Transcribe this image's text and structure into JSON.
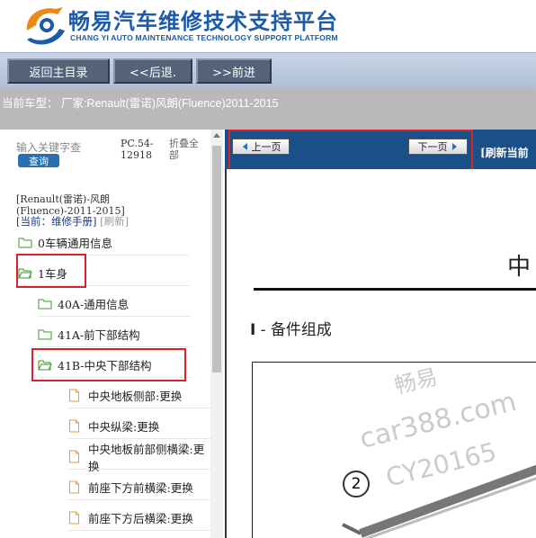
{
  "header": {
    "title": "畅易汽车维修技术支持平台",
    "subtitle": "CHANG YI AUTO MAINTENANCE TECHNOLOGY SUPPORT PLATFORM"
  },
  "toolbar": {
    "home_label": "返回主目录",
    "back_label": "<<后退.",
    "forward_label": ">>前进"
  },
  "vehicle": {
    "text": "当前车型： 厂家:Renault(雷诺)风朗(Fluence)2011-2015"
  },
  "sidebar": {
    "search_placeholder": "输入关键字查",
    "query_label": "查询",
    "pc_code": "PC.54-12918",
    "fold_label": "折叠全部",
    "crumb_car": "[Renault(雷诺)-风朗(Fluence)-2011-2015]",
    "crumb_current": "[当前：维修手册]",
    "refresh_label": "[刷新]",
    "tree": [
      {
        "label": "0车辆通用信息",
        "type": "folder"
      },
      {
        "label": "1车身",
        "type": "folder-open"
      },
      {
        "label": "40A-通用信息",
        "type": "folder"
      },
      {
        "label": "41A-前下部结构",
        "type": "folder"
      },
      {
        "label": "41B-中央下部结构",
        "type": "folder-open"
      },
      {
        "label": "中央地板侧部:更换",
        "type": "doc"
      },
      {
        "label": "中央纵梁:更换",
        "type": "doc"
      },
      {
        "label": "中央地板前部侧横梁:更换",
        "type": "doc"
      },
      {
        "label": "前座下方前横梁:更换",
        "type": "doc"
      },
      {
        "label": "前座下方后横梁:更换",
        "type": "doc"
      }
    ]
  },
  "pager": {
    "prev_label": "上一页",
    "next_label": "下一页",
    "refresh_label": "[刷新当前"
  },
  "document": {
    "heading": "中",
    "section_num": "I",
    "section_title": " - 备件组成",
    "callout": "2",
    "watermarks": [
      "畅易",
      "car388.com",
      "CY20165"
    ]
  },
  "colors": {
    "brand_blue": "#1d5aa8",
    "highlight_red": "#d8232a",
    "pager_bar": "#1a4f88",
    "folder_green": "#3f9b2f",
    "doc_orange": "#e89a3c"
  }
}
